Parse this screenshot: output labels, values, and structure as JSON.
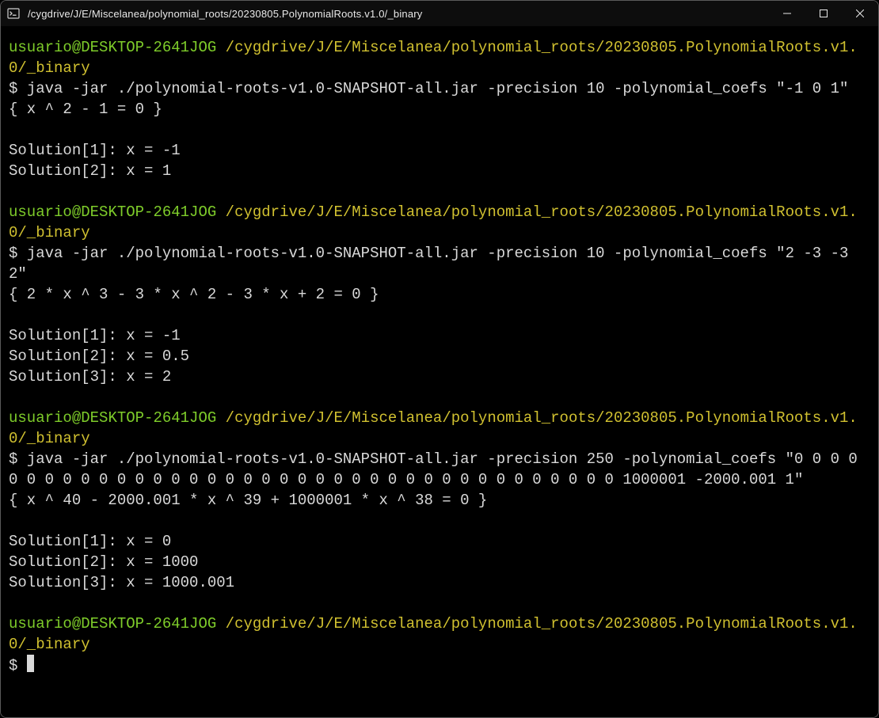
{
  "window": {
    "title": "/cygdrive/J/E/Miscelanea/polynomial_roots/20230805.PolynomialRoots.v1.0/_binary",
    "icon": "terminal-icon"
  },
  "prompt": {
    "user": "usuario",
    "at": "@",
    "host": "DESKTOP-2641JOG",
    "sep": " ",
    "path": "/cygdrive/J/E/Miscelanea/polynomial_roots/20230805.PolynomialRoots.v1.0/_binary",
    "symbol": "$"
  },
  "blocks": [
    {
      "cmd": "java -jar ./polynomial-roots-v1.0-SNAPSHOT-all.jar -precision 10 -polynomial_coefs \"-1 0 1\"",
      "out": "{ x ^ 2 - 1 = 0 }\n\nSolution[1]: x = -1\nSolution[2]: x = 1"
    },
    {
      "cmd": "java -jar ./polynomial-roots-v1.0-SNAPSHOT-all.jar -precision 10 -polynomial_coefs \"2 -3 -3 2\"",
      "out": "{ 2 * x ^ 3 - 3 * x ^ 2 - 3 * x + 2 = 0 }\n\nSolution[1]: x = -1\nSolution[2]: x = 0.5\nSolution[3]: x = 2"
    },
    {
      "cmd": "java -jar ./polynomial-roots-v1.0-SNAPSHOT-all.jar -precision 250 -polynomial_coefs \"0 0 0 0 0 0 0 0 0 0 0 0 0 0 0 0 0 0 0 0 0 0 0 0 0 0 0 0 0 0 0 0 0 0 0 0 0 0 1000001 -2000.001 1\"",
      "out": "{ x ^ 40 - 2000.001 * x ^ 39 + 1000001 * x ^ 38 = 0 }\n\nSolution[1]: x = 0\nSolution[2]: x = 1000\nSolution[3]: x = 1000.001"
    }
  ],
  "trailing_prompt": true
}
